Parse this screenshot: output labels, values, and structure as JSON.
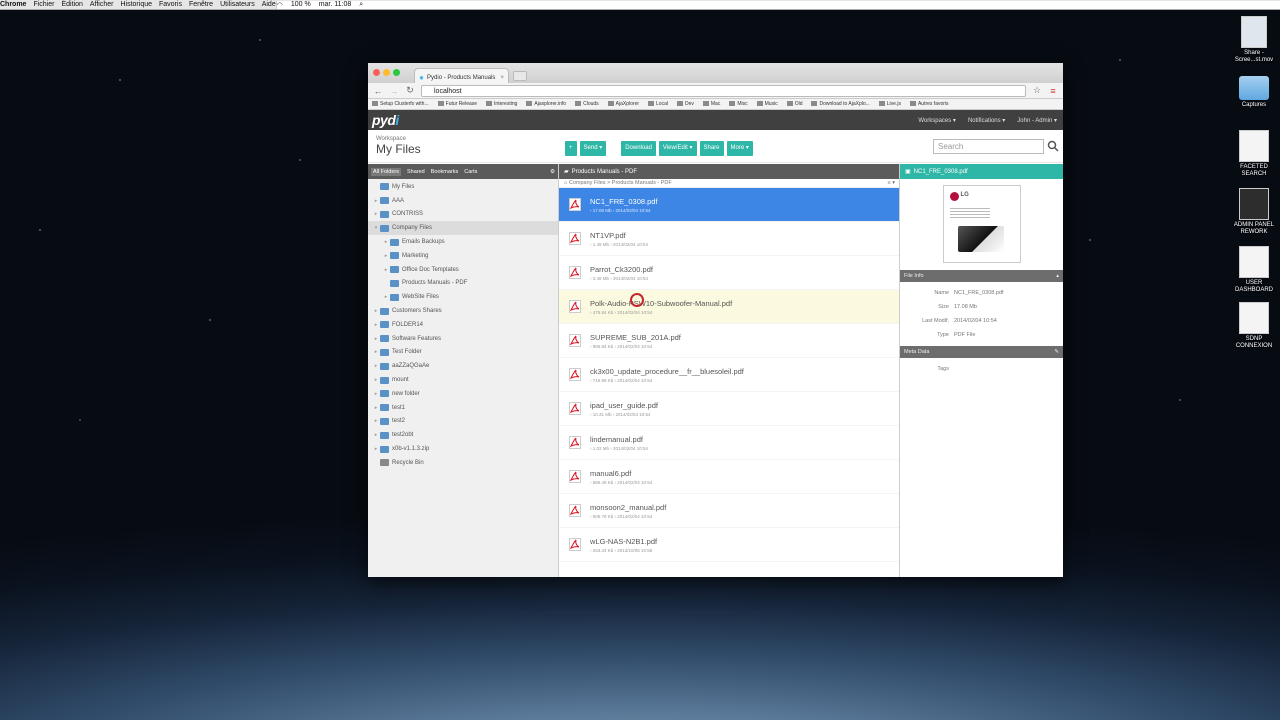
{
  "menubar": {
    "app": "Chrome",
    "items": [
      "Fichier",
      "Édition",
      "Afficher",
      "Historique",
      "Favoris",
      "Fenêtre",
      "Utilisateurs",
      "Aide"
    ],
    "battery": "100 %",
    "clock": "mar. 11:08"
  },
  "desktop": {
    "icons": [
      {
        "label": "Share - Scree...st.mov"
      },
      {
        "label": "Captures"
      },
      {
        "label": "FACETED SEARCH"
      },
      {
        "label": "ADMIN PANEL REWORK"
      },
      {
        "label": "USER DASHBOARD"
      },
      {
        "label": "SDNP CONNEXION"
      }
    ]
  },
  "browser": {
    "tab_title": "Pydio - Products Manuals",
    "url": "localhost",
    "bookmarks": [
      "Setup Clusterfs with...",
      "Futur Release",
      "Interesting",
      "Ajaxplorer.info",
      "Clouds",
      "AjaXplorer",
      "Local",
      "Dev",
      "Mac",
      "Misc",
      "Music",
      "Old",
      "Download to AjaXplo...",
      "Live.js",
      "Autres favoris"
    ]
  },
  "pydio": {
    "logo_main": "pyd",
    "logo_accent": "i",
    "workspaces": "Workspaces ▾",
    "notifications": "Notifications ▾",
    "user": "John - Admin ▾",
    "workspace_label": "Workspace",
    "workspace_title": "My Files",
    "toolbar": {
      "add": "+",
      "send": "Send ▾",
      "download": "Download",
      "view_edit": "View/Edit ▾",
      "share": "Share",
      "more": "More ▾"
    },
    "search_placeholder": "Search",
    "left_tabs": [
      "All Folders",
      "Shared",
      "Bookmarks",
      "Carts"
    ],
    "tree": [
      {
        "label": "My Files",
        "indent": 0,
        "tw": ""
      },
      {
        "label": "AAA",
        "indent": 0,
        "tw": "▸"
      },
      {
        "label": "CONTRISS",
        "indent": 0,
        "tw": "▸"
      },
      {
        "label": "Company Files",
        "indent": 0,
        "tw": "▾",
        "sel": true
      },
      {
        "label": "Emails Backups",
        "indent": 1,
        "tw": "▸"
      },
      {
        "label": "Marketing",
        "indent": 1,
        "tw": "▸"
      },
      {
        "label": "Office Doc Templates",
        "indent": 1,
        "tw": "▸"
      },
      {
        "label": "Products Manuals - PDF",
        "indent": 1,
        "tw": ""
      },
      {
        "label": "WebSite Files",
        "indent": 1,
        "tw": "▸"
      },
      {
        "label": "Customers Shares",
        "indent": 0,
        "tw": "▸"
      },
      {
        "label": "FOLDER14",
        "indent": 0,
        "tw": "▸"
      },
      {
        "label": "Software Features",
        "indent": 0,
        "tw": "▸"
      },
      {
        "label": "Test Folder",
        "indent": 0,
        "tw": "▸"
      },
      {
        "label": "aaZZaQGaAe",
        "indent": 0,
        "tw": "▸"
      },
      {
        "label": "mount",
        "indent": 0,
        "tw": "▸"
      },
      {
        "label": "new folder",
        "indent": 0,
        "tw": "▸"
      },
      {
        "label": "test1",
        "indent": 0,
        "tw": "▸"
      },
      {
        "label": "test2",
        "indent": 0,
        "tw": "▸"
      },
      {
        "label": "test2obt",
        "indent": 0,
        "tw": "▸"
      },
      {
        "label": "x0b-v1.1.3.zip",
        "indent": 0,
        "tw": "▸"
      },
      {
        "label": "Recycle Bin",
        "indent": 0,
        "tw": ""
      }
    ],
    "center_title": "Products Manuals - PDF",
    "breadcrumb": "Company Files > Products Manuals - PDF",
    "files": [
      {
        "name": "NC1_FRE_0308.pdf",
        "meta": "› 17.08 Mb › 2014/02/04 10:54"
      },
      {
        "name": "NT1VP.pdf",
        "meta": "› 1.49 Mb › 2014/02/04 10:54"
      },
      {
        "name": "Parrot_Ck3200.pdf",
        "meta": "› 3.48 Mb › 2014/02/04 10:54"
      },
      {
        "name": "Polk-Audio-PSW10-Subwoofer-Manual.pdf",
        "meta": "› 475.84 Kb › 2014/02/04 10:54"
      },
      {
        "name": "SUPREME_SUB_201A.pdf",
        "meta": "› 886.84 Kb › 2014/02/04 10:54"
      },
      {
        "name": "ck3x00_update_procedure__fr__bluesoleil.pdf",
        "meta": "› 715.98 Kb › 2014/02/04 10:54"
      },
      {
        "name": "ipad_user_guide.pdf",
        "meta": "› 10.31 Mb › 2014/02/04 10:54"
      },
      {
        "name": "lindemanual.pdf",
        "meta": "› 1.02 Mb › 2014/02/04 10:54"
      },
      {
        "name": "manual6.pdf",
        "meta": "› 686.49 Kb › 2014/02/04 10:54"
      },
      {
        "name": "monsoon2_manual.pdf",
        "meta": "› 505.78 Kb › 2014/02/04 10:54"
      },
      {
        "name": "wLG-NAS-N2B1.pdf",
        "meta": "› 263.34 Kb › 2013/10/06 10:58"
      }
    ],
    "right_title": "NC1_FRE_0308.pdf",
    "preview_brand": "LG",
    "file_info_title": "File Info",
    "file_info": [
      {
        "k": "Name",
        "v": "NC1_FRE_0308.pdf"
      },
      {
        "k": "Size",
        "v": "17.08 Mb"
      },
      {
        "k": "Last Modif.",
        "v": "2014/02/04 10:54"
      },
      {
        "k": "Type",
        "v": "PDF File"
      }
    ],
    "meta_title": "Meta Data",
    "meta_tags_label": "Tags"
  },
  "colors": {
    "teal": "#2eb6a6",
    "selected": "#3d86e6",
    "hover": "#fbf9df",
    "topbar": "#404040"
  }
}
